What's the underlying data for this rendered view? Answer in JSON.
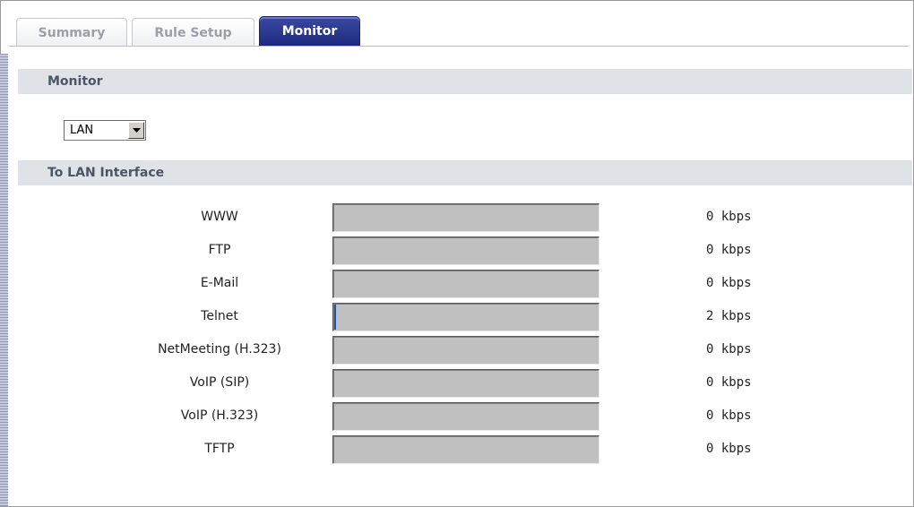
{
  "tabs": [
    {
      "label": "Summary",
      "active": false
    },
    {
      "label": "Rule Setup",
      "active": false
    },
    {
      "label": "Monitor",
      "active": true
    }
  ],
  "monitor_section": {
    "title": "Monitor",
    "interface_select": {
      "value": "LAN"
    }
  },
  "lan_section": {
    "title": "To LAN Interface",
    "rows": [
      {
        "label": "WWW",
        "rate": "0 kbps",
        "level": 0
      },
      {
        "label": "FTP",
        "rate": "0 kbps",
        "level": 0
      },
      {
        "label": "E-Mail",
        "rate": "0 kbps",
        "level": 0
      },
      {
        "label": "Telnet",
        "rate": "2 kbps",
        "level": 0.008
      },
      {
        "label": "NetMeeting (H.323)",
        "rate": "0 kbps",
        "level": 0
      },
      {
        "label": "VoIP (SIP)",
        "rate": "0 kbps",
        "level": 0
      },
      {
        "label": "VoIP (H.323)",
        "rate": "0 kbps",
        "level": 0
      },
      {
        "label": "TFTP",
        "rate": "0 kbps",
        "level": 0
      }
    ]
  },
  "colors": {
    "active_tab": "#1d2a80",
    "section_bar": "#dfe2e6",
    "meter_fill": "#1f4fb3",
    "meter_bg": "#c0c0c0"
  },
  "icons": {
    "select_arrow": "chevron-down-icon"
  }
}
